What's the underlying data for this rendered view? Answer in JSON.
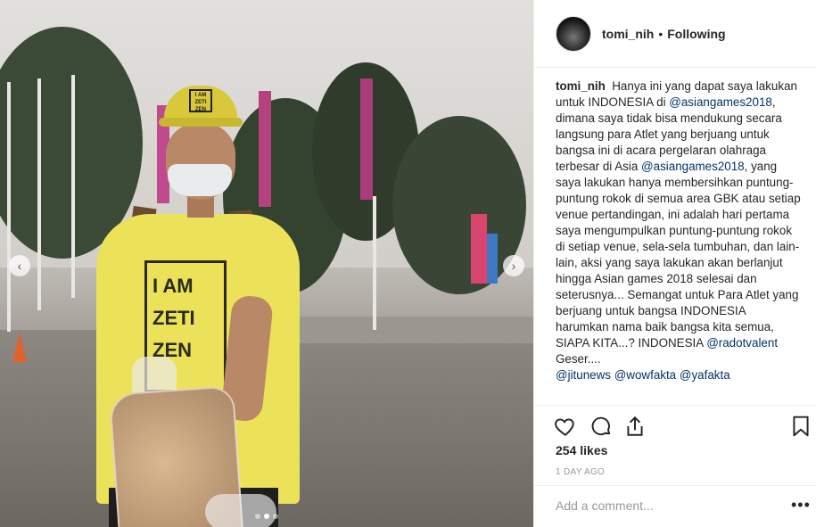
{
  "post": {
    "photo": {
      "cap_logo": "I AM\nZETI\nZEN",
      "tee_print": "I AM\nZETI\nZEN",
      "nav_prev": "‹",
      "nav_next": "›",
      "carousel_dots": 3,
      "active_dot_index": 1
    },
    "header": {
      "username": "tomi_nih",
      "separator": "•",
      "follow_status": "Following"
    },
    "caption": {
      "username": "tomi_nih",
      "segments": [
        {
          "type": "text",
          "value": "Hanya ini yang dapat saya lakukan untuk INDONESIA di "
        },
        {
          "type": "mention",
          "value": "@asiangames2018"
        },
        {
          "type": "text",
          "value": ", dimana saya tidak bisa mendukung secara langsung para Atlet yang berjuang untuk bangsa ini di acara pergelaran olahraga terbesar di Asia "
        },
        {
          "type": "mention",
          "value": "@asiangames2018"
        },
        {
          "type": "text",
          "value": ", yang saya lakukan hanya membersihkan puntung-puntung rokok di semua area GBK atau setiap venue pertandingan, ini adalah hari pertama saya mengumpulkan puntung-puntung rokok di setiap venue, sela-sela tumbuhan, dan lain-lain, aksi yang saya lakukan akan berlanjut hingga Asian games 2018 selesai dan seterusnya... Semangat untuk Para Atlet yang berjuang untuk bangsa INDONESIA harumkan nama baik bangsa kita semua, SIAPA KITA...? INDONESIA "
        },
        {
          "type": "mention",
          "value": "@radotvalent"
        },
        {
          "type": "text",
          "value": "\nGeser....\n"
        },
        {
          "type": "mention",
          "value": "@jitunews"
        },
        {
          "type": "text",
          "value": " "
        },
        {
          "type": "mention",
          "value": "@wowfakta"
        },
        {
          "type": "text",
          "value": " "
        },
        {
          "type": "mention",
          "value": "@yafakta"
        }
      ]
    },
    "actions": {
      "like_icon": "heart-icon",
      "comment_icon": "comment-bubble-icon",
      "share_icon": "share-icon",
      "save_icon": "bookmark-icon"
    },
    "likes_text": "254 likes",
    "time_text": "1 DAY AGO",
    "add_comment_placeholder": "Add a comment...",
    "more_options": "•••"
  },
  "colors": {
    "mention": "#003569",
    "text": "#262626",
    "muted": "#999999",
    "divider": "#efefef",
    "shirt": "#ece25a"
  }
}
